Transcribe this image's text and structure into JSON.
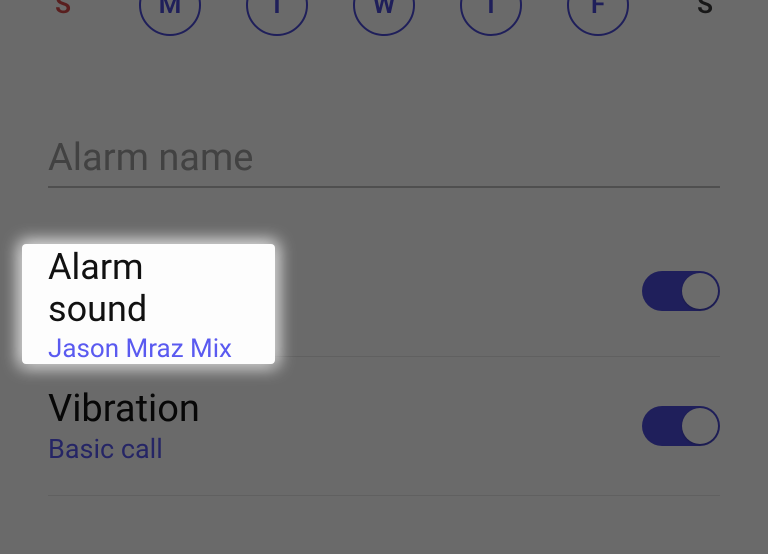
{
  "days": {
    "sun": "S",
    "mon": "M",
    "tue": "T",
    "wed": "W",
    "thu": "T",
    "fri": "F",
    "sat": "S"
  },
  "alarm_name": {
    "placeholder": "Alarm name",
    "value": ""
  },
  "alarm_sound": {
    "title": "Alarm sound",
    "value": "Jason Mraz Mix",
    "enabled": true
  },
  "vibration": {
    "title": "Vibration",
    "value": "Basic call",
    "enabled": true
  },
  "colors": {
    "accent": "#4b4bd8",
    "link": "#5a5af0",
    "sunday": "#d44a4a"
  }
}
